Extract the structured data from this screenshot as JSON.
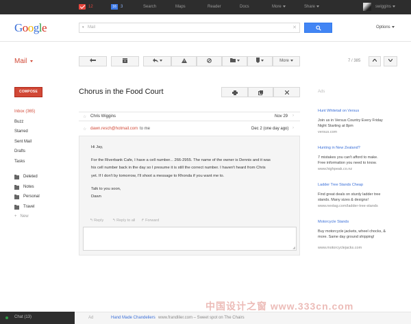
{
  "topbar": {
    "mail_count": "12",
    "calendar_icon_text": "16",
    "calendar_count": "3",
    "links": [
      "Search",
      "Maps",
      "Reader",
      "Docs",
      "More",
      "Share"
    ],
    "user": "swiggins"
  },
  "header": {
    "logo_letters": [
      "G",
      "o",
      "o",
      "g",
      "l",
      "e"
    ],
    "search_placeholder": "Mail",
    "options_label": "Options"
  },
  "toolbar": {
    "mail_label": "Mail",
    "more_label": "More",
    "pager": "7 / 385"
  },
  "sidebar": {
    "compose_label": "COMPOSE",
    "items": [
      "Inbox (365)",
      "Buzz",
      "Starred",
      "Sent Mail",
      "Drafts",
      "Tasks"
    ],
    "labels": [
      "Deleted",
      "Notes",
      "Personal",
      "Travel"
    ],
    "new_label": "New"
  },
  "thread": {
    "subject": "Chorus in the Food Court",
    "messages": [
      {
        "sender": "Chris Wiggins",
        "date": "Nov 29"
      },
      {
        "sender": "dawn.resch@hotmail.com",
        "to": "to me",
        "date": "Dec 2 (one day ago)"
      }
    ],
    "body": {
      "greeting": "Hi Jay,",
      "line1": "For the Riverbank Cafe, I have a cell number... 266-2955. The name of the owner is Dennis and it was",
      "line2": "his cell number back in the day so I presume it is still the correct number. I haven't heard from Chris",
      "line3": "yet. If I don't by tomorrow, I'll shoot a message to Rhonda if you want me to.",
      "closing": "Talk to you soon,",
      "signature": "Dawn"
    },
    "reply_actions": [
      "Reply",
      "Reply to all",
      "Forward"
    ]
  },
  "ads": {
    "label": "Ads",
    "items": [
      {
        "title": "Hunt Whitetail on Versus",
        "body": "Join us in Versus Country Every Friday Night Starting at 8pm",
        "url": "versus.com"
      },
      {
        "title": "Hunting in New Zealand?",
        "body": "7 mistakes you can't afford to make. Free information you need to know.",
        "url": "www.highpeak.co.nz"
      },
      {
        "title": "Ladder Tree Stands Cheap",
        "body": "Find great deals on sturdy ladder tree stands. Many sizes & designs!",
        "url": "www.nextag.com/ladder-tree-stands"
      },
      {
        "title": "Motorcycle Stands",
        "body": "Buy motorcycle jackets, wheel chocks, & more. Same day ground shipping!",
        "url": "www.motorcyclejacks.com"
      }
    ]
  },
  "footer": {
    "chat_label": "Chat (13)",
    "ad_label": "Ad",
    "ad_title": "Hand Made Chandeliers",
    "ad_text": "www.frandliler.com – Sweet spot on The Chairs"
  },
  "watermark": "中国设计之窗 www.333cn.com",
  "colors": {
    "accent": "#d14836",
    "link": "#3a6fd8",
    "topbar": "#2d2d2d",
    "search_button": "#4285f4"
  }
}
